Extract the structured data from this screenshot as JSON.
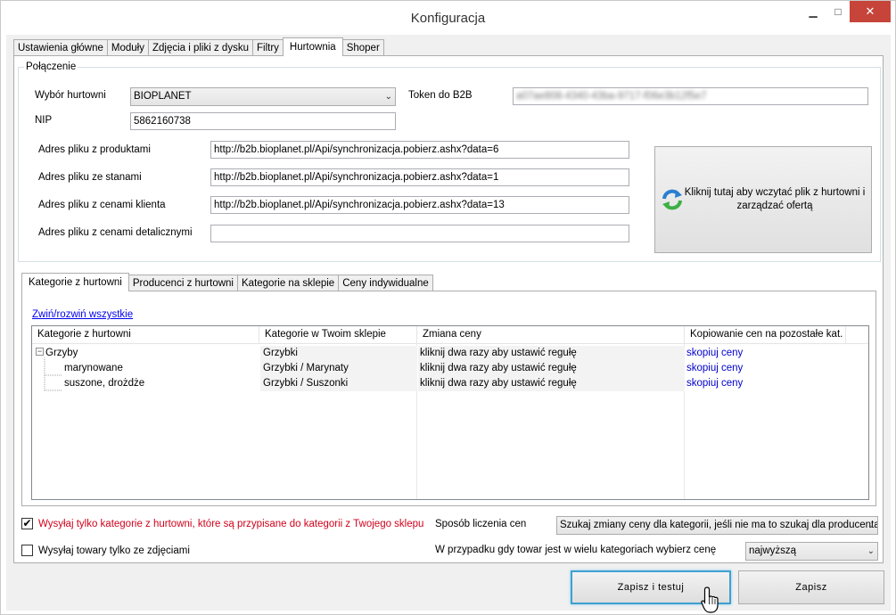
{
  "window": {
    "title": "Konfiguracja",
    "controls": {
      "minimize": "▁",
      "maximize": "□",
      "close": "✕"
    }
  },
  "tabs": [
    "Ustawienia główne",
    "Moduły",
    "Zdjęcia i pliki z dysku",
    "Filtry",
    "Hurtownia",
    "Shoper"
  ],
  "active_tab": "Hurtownia",
  "connection": {
    "legend": "Połączenie",
    "wholesaler_label": "Wybór hurtowni",
    "wholesaler_value": "BIOPLANET",
    "token_label": "Token do B2B",
    "token_value": "a07ae808-4340-43ba-9717-f06e3b12f5e7",
    "nip_label": "NIP",
    "nip_value": "5862160738",
    "products_label": "Adres pliku z produktami",
    "products_value": "http://b2b.bioplanet.pl/Api/synchronizacja.pobierz.ashx?data=6",
    "stock_label": "Adres pliku ze stanami",
    "stock_value": "http://b2b.bioplanet.pl/Api/synchronizacja.pobierz.ashx?data=1",
    "client_prices_label": "Adres pliku z cenami klienta",
    "client_prices_value": "http://b2b.bioplanet.pl/Api/synchronizacja.pobierz.ashx?data=13",
    "retail_prices_label": "Adres pliku z cenami detalicznymi",
    "retail_prices_value": "",
    "load_button": "Kliknij tutaj aby wczytać plik z hurtowni i zarządzać ofertą"
  },
  "inner_tabs": [
    "Kategorie z hurtowni",
    "Producenci z hurtowni",
    "Kategorie na sklepie",
    "Ceny indywidualne"
  ],
  "active_inner_tab": "Kategorie z hurtowni",
  "toggle_link": "Zwiń/rozwiń wszystkie",
  "tree": {
    "columns": [
      "Kategorie z hurtowni",
      "Kategorie w Twoim sklepie",
      "Zmiana ceny",
      "Kopiowanie cen na pozostałe kat."
    ],
    "rows": [
      {
        "expander": "−",
        "category": "Grzyby",
        "shop_category": "Grzybki",
        "price_change": "kliknij dwa razy aby ustawić regułę",
        "copy": "skopiuj ceny"
      },
      {
        "expander": "",
        "category": "marynowane",
        "shop_category": "Grzybki / Marynaty",
        "price_change": "kliknij dwa razy aby ustawić regułę",
        "copy": "skopiuj ceny"
      },
      {
        "expander": "",
        "category": "suszone, drożdże",
        "shop_category": "Grzybki / Suszonki",
        "price_change": "kliknij dwa razy aby ustawić regułę",
        "copy": "skopiuj ceny"
      }
    ]
  },
  "options": {
    "send_only_assigned_label": "Wysyłaj tylko kategorie z hurtowni, które są przypisane do kategorii z Twojego sklepu",
    "send_only_assigned_checked": "✔",
    "send_only_photos_label": "Wysyłaj towary tylko ze zdjęciami",
    "send_only_photos_checked": "",
    "pricing_method_label": "Sposób liczenia cen",
    "pricing_method_value": "Szukaj zmiany ceny dla kategorii, jeśli nie ma to szukaj dla producenta",
    "multi_category_label": "W przypadku gdy towar jest w wielu kategoriach wybierz cenę",
    "multi_category_value": "najwyższą"
  },
  "buttons": {
    "save_test": "Zapisz i testuj",
    "save": "Zapisz"
  },
  "colors": {
    "warning_text": "#d0021b",
    "link": "#0000ee",
    "focus": "#3fa0cf",
    "close": "#c7443b"
  }
}
